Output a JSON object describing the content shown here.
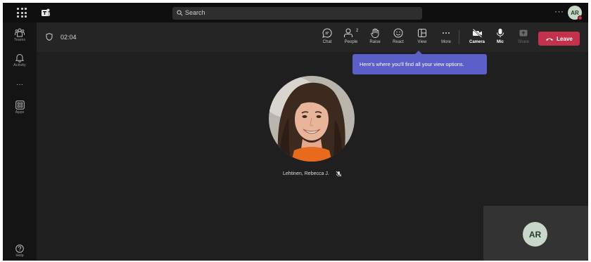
{
  "titlebar": {
    "search_placeholder": "Search",
    "more_label": "···",
    "avatar_initials": "AR"
  },
  "rail": {
    "items": [
      {
        "label": "Teams",
        "icon": "teams-icon"
      },
      {
        "label": "Activity",
        "icon": "bell-icon"
      },
      {
        "label": "···",
        "icon": "more-icon"
      },
      {
        "label": "Apps",
        "icon": "apps-icon"
      },
      {
        "label": "Help",
        "icon": "help-icon"
      }
    ]
  },
  "meeting": {
    "timer": "02:04",
    "people_count": "2",
    "controls": {
      "chat": "Chat",
      "people": "People",
      "raise": "Raise",
      "react": "React",
      "view": "View",
      "more": "More",
      "camera": "Camera",
      "mic": "Mic",
      "share": "Share"
    },
    "leave_label": "Leave",
    "tooltip": "Here's where you'll find all your view options.",
    "participant_name": "Lehtinen, Rebecca J.",
    "self_initials": "AR"
  },
  "colors": {
    "leave": "#c4314b",
    "tooltip": "#5b5fc7",
    "avatar_bg": "#c8d8c8"
  }
}
